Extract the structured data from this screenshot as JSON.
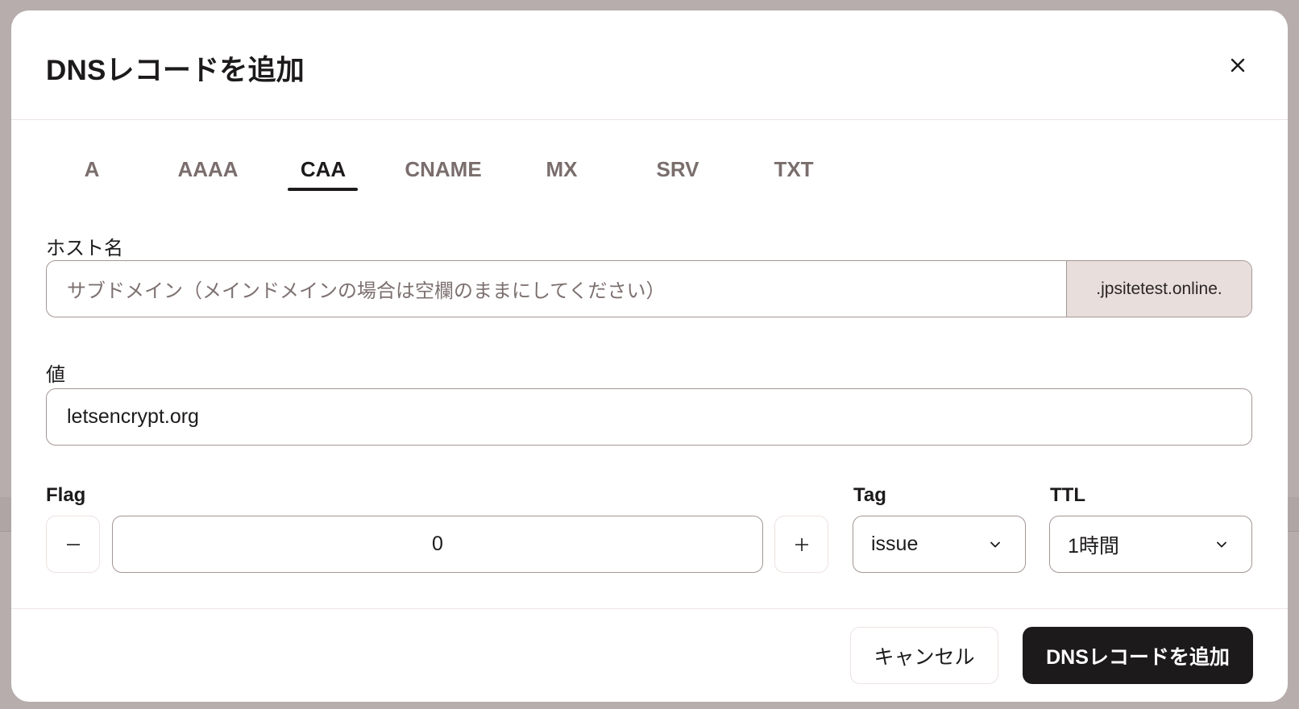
{
  "dialog": {
    "title": "DNSレコードを追加",
    "close_icon": "close-icon"
  },
  "tabs": [
    {
      "label": "A",
      "active": false
    },
    {
      "label": "AAAA",
      "active": false
    },
    {
      "label": "CAA",
      "active": true
    },
    {
      "label": "CNAME",
      "active": false
    },
    {
      "label": "MX",
      "active": false
    },
    {
      "label": "SRV",
      "active": false
    },
    {
      "label": "TXT",
      "active": false
    }
  ],
  "form": {
    "hostname": {
      "label": "ホスト名",
      "value": "",
      "placeholder": "サブドメイン（メインドメインの場合は空欄のままにしてください）",
      "suffix": ".jpsitetest.online."
    },
    "value": {
      "label": "値",
      "value": "letsencrypt.org"
    },
    "flag": {
      "label": "Flag",
      "value": "0",
      "decrement_icon": "minus-icon",
      "increment_icon": "plus-icon"
    },
    "tag": {
      "label": "Tag",
      "selected": "issue",
      "icon": "chevron-down-icon"
    },
    "ttl": {
      "label": "TTL",
      "selected": "1時間",
      "icon": "chevron-down-icon"
    }
  },
  "footer": {
    "cancel_label": "キャンセル",
    "submit_label": "DNSレコードを追加"
  },
  "colors": {
    "primary": "#1c1a1a",
    "muted_text": "#7a6e6d",
    "addon_bg": "#e8dedb",
    "backdrop": "#b6adac"
  }
}
